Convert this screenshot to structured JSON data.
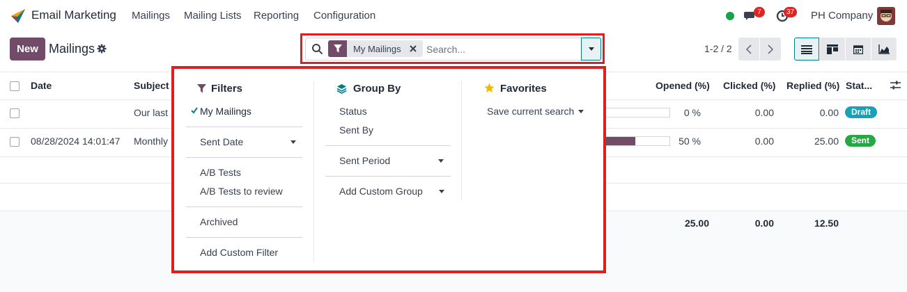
{
  "navbar": {
    "app_name": "Email Marketing",
    "menu": [
      "Mailings",
      "Mailing Lists",
      "Reporting",
      "Configuration"
    ],
    "messages_count": "7",
    "activities_count": "37",
    "company": "PH Company"
  },
  "control": {
    "new_label": "New",
    "title": "Mailings",
    "facet_label": "My Mailings",
    "search_placeholder": "Search...",
    "pager": "1-2 / 2"
  },
  "table": {
    "headers": {
      "date": "Date",
      "subject": "Subject",
      "opened": "Opened (%)",
      "clicked": "Clicked (%)",
      "replied": "Replied (%)",
      "status": "Stat..."
    },
    "rows": [
      {
        "date": "",
        "subject": "Our last",
        "opened_label": "0 %",
        "opened_fraction": 0.0,
        "clicked": "0.00",
        "replied": "0.00",
        "status": "Draft",
        "status_color": "#17a2b8"
      },
      {
        "date": "08/28/2024 14:01:47",
        "subject": "Monthly",
        "opened_label": "50 %",
        "opened_fraction": 0.5,
        "clicked": "0.00",
        "replied": "25.00",
        "status": "Sent",
        "status_color": "#28a745"
      }
    ],
    "totals": {
      "opened": "25.00",
      "clicked": "0.00",
      "replied": "12.50"
    }
  },
  "dropdown": {
    "filters": {
      "title": "Filters",
      "items": [
        "My Mailings",
        "Sent Date",
        "A/B Tests",
        "A/B Tests to review",
        "Archived",
        "Add Custom Filter"
      ]
    },
    "groupby": {
      "title": "Group By",
      "items": [
        "Status",
        "Sent By",
        "Sent Period",
        "Add Custom Group"
      ]
    },
    "favorites": {
      "title": "Favorites",
      "items": [
        "Save current search"
      ]
    }
  },
  "colors": {
    "brand": "#714b67",
    "accent": "#017e84",
    "highlight": "#e11d1d"
  }
}
